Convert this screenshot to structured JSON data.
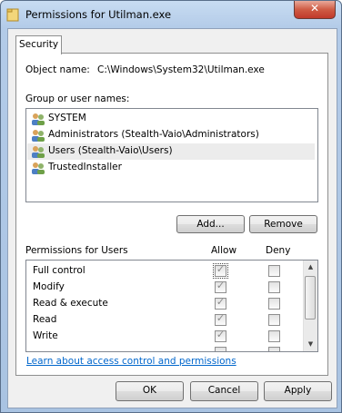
{
  "window": {
    "title": "Permissions for Utilman.exe",
    "close_glyph": "✕"
  },
  "tabs": [
    {
      "label": "Security"
    }
  ],
  "object": {
    "label": "Object name:",
    "value": "C:\\Windows\\System32\\Utilman.exe"
  },
  "groups": {
    "label": "Group or user names:",
    "items": [
      {
        "label": "SYSTEM",
        "selected": false
      },
      {
        "label": "Administrators (Stealth-Vaio\\Administrators)",
        "selected": false
      },
      {
        "label": "Users (Stealth-Vaio\\Users)",
        "selected": true
      },
      {
        "label": "TrustedInstaller",
        "selected": false
      }
    ],
    "icon": "users-group-icon"
  },
  "buttons": {
    "add": "Add...",
    "remove": "Remove",
    "ok": "OK",
    "cancel": "Cancel",
    "apply": "Apply"
  },
  "permissions": {
    "label": "Permissions for Users",
    "allow_header": "Allow",
    "deny_header": "Deny",
    "rows": [
      {
        "name": "Full control",
        "allow": true,
        "deny": false
      },
      {
        "name": "Modify",
        "allow": true,
        "deny": false
      },
      {
        "name": "Read & execute",
        "allow": true,
        "deny": false
      },
      {
        "name": "Read",
        "allow": true,
        "deny": false
      },
      {
        "name": "Write",
        "allow": true,
        "deny": false
      }
    ],
    "check_glyph": "✓",
    "scroll_up": "▲",
    "scroll_down": "▼"
  },
  "link": "Learn about access control and permissions",
  "colors": {
    "link": "#0066cc",
    "selected_row": "#ececec",
    "close_button": "#c0392b"
  }
}
